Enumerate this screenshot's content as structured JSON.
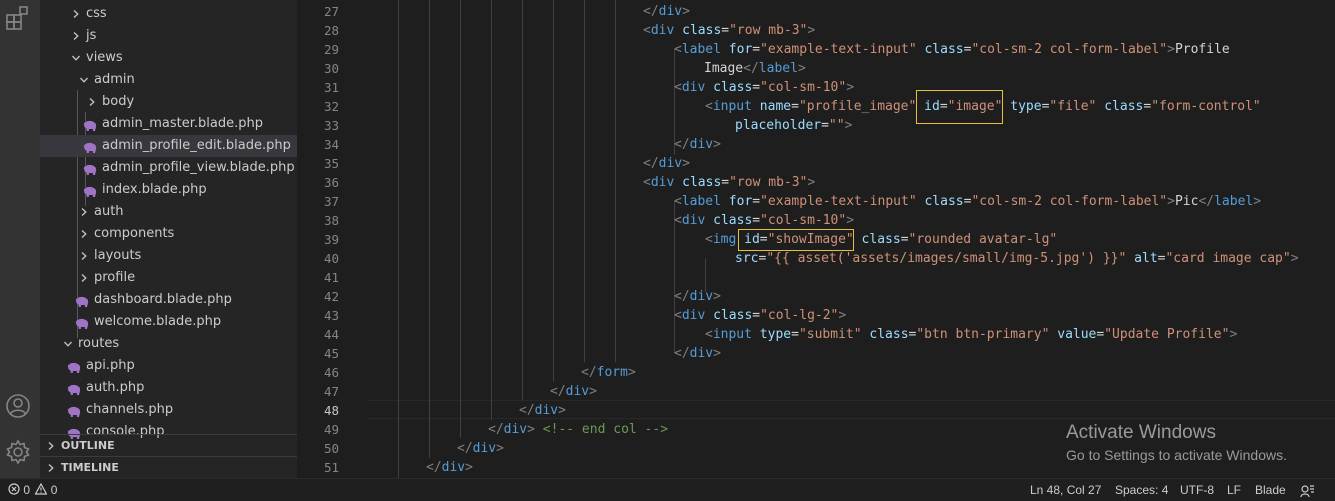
{
  "explorer": {
    "items": [
      {
        "label": "css",
        "chevron": "right",
        "icon": "none"
      },
      {
        "label": "js",
        "chevron": "right",
        "icon": "none"
      },
      {
        "label": "views",
        "chevron": "down",
        "icon": "none"
      },
      {
        "label": "admin",
        "chevron": "down",
        "icon": "none"
      },
      {
        "label": "body",
        "chevron": "right",
        "icon": "none"
      },
      {
        "label": "admin_master.blade.php",
        "chevron": "none",
        "icon": "php"
      },
      {
        "label": "admin_profile_edit.blade.php",
        "chevron": "none",
        "icon": "php",
        "active": true
      },
      {
        "label": "admin_profile_view.blade.php",
        "chevron": "none",
        "icon": "php"
      },
      {
        "label": "index.blade.php",
        "chevron": "none",
        "icon": "php"
      },
      {
        "label": "auth",
        "chevron": "right",
        "icon": "none"
      },
      {
        "label": "components",
        "chevron": "right",
        "icon": "none"
      },
      {
        "label": "layouts",
        "chevron": "right",
        "icon": "none"
      },
      {
        "label": "profile",
        "chevron": "right",
        "icon": "none"
      },
      {
        "label": "dashboard.blade.php",
        "chevron": "none",
        "icon": "php"
      },
      {
        "label": "welcome.blade.php",
        "chevron": "none",
        "icon": "php"
      },
      {
        "label": "routes",
        "chevron": "down",
        "icon": "none"
      },
      {
        "label": "api.php",
        "chevron": "none",
        "icon": "php"
      },
      {
        "label": "auth.php",
        "chevron": "none",
        "icon": "php"
      },
      {
        "label": "channels.php",
        "chevron": "none",
        "icon": "php"
      },
      {
        "label": "console.php",
        "chevron": "none",
        "icon": "php"
      }
    ],
    "outline_label": "OUTLINE",
    "timeline_label": "TIMELINE"
  },
  "editor": {
    "current_line": "48",
    "lines": [
      {
        "num": "27",
        "tokens": [
          [
            "t-punc",
            "</"
          ],
          [
            "t-tag",
            "div"
          ],
          [
            "t-punc",
            ">"
          ]
        ]
      },
      {
        "num": "28",
        "tokens": [
          [
            "t-punc",
            "<"
          ],
          [
            "t-tag",
            "div "
          ],
          [
            "t-attr",
            "class"
          ],
          [
            "t-eq",
            "="
          ],
          [
            "t-str",
            "\"row mb-3\""
          ],
          [
            "t-punc",
            ">"
          ]
        ]
      },
      {
        "num": "29",
        "tokens": [
          [
            "t-punc",
            "<"
          ],
          [
            "t-tag",
            "label "
          ],
          [
            "t-attr",
            "for"
          ],
          [
            "t-eq",
            "="
          ],
          [
            "t-str",
            "\"example-text-input\" "
          ],
          [
            "t-attr",
            "class"
          ],
          [
            "t-eq",
            "="
          ],
          [
            "t-str",
            "\"col-sm-2 col-form-label\""
          ],
          [
            "t-punc",
            ">"
          ],
          [
            "t-text",
            "Profile"
          ]
        ]
      },
      {
        "num": "30",
        "tokens": [
          [
            "t-text",
            "Image"
          ],
          [
            "t-punc",
            "</"
          ],
          [
            "t-tag",
            "label"
          ],
          [
            "t-punc",
            ">"
          ]
        ]
      },
      {
        "num": "31",
        "tokens": [
          [
            "t-punc",
            "<"
          ],
          [
            "t-tag",
            "div "
          ],
          [
            "t-attr",
            "class"
          ],
          [
            "t-eq",
            "="
          ],
          [
            "t-str",
            "\"col-sm-10\""
          ],
          [
            "t-punc",
            ">"
          ]
        ]
      },
      {
        "num": "32",
        "tokens": [
          [
            "t-punc",
            "<"
          ],
          [
            "t-tag",
            "input "
          ],
          [
            "t-attr",
            "name"
          ],
          [
            "t-eq",
            "="
          ],
          [
            "t-str",
            "\"profile_image\" "
          ],
          [
            "t-attr",
            "id"
          ],
          [
            "t-eq",
            "="
          ],
          [
            "t-str",
            "\"image\" "
          ],
          [
            "t-attr",
            "type"
          ],
          [
            "t-eq",
            "="
          ],
          [
            "t-str",
            "\"file\" "
          ],
          [
            "t-attr",
            "class"
          ],
          [
            "t-eq",
            "="
          ],
          [
            "t-str",
            "\"form-control\""
          ]
        ]
      },
      {
        "num": "33",
        "tokens": [
          [
            "t-attr",
            "placeholder"
          ],
          [
            "t-eq",
            "="
          ],
          [
            "t-str",
            "\"\""
          ],
          [
            "t-punc",
            ">"
          ]
        ]
      },
      {
        "num": "34",
        "tokens": [
          [
            "t-punc",
            "</"
          ],
          [
            "t-tag",
            "div"
          ],
          [
            "t-punc",
            ">"
          ]
        ]
      },
      {
        "num": "35",
        "tokens": [
          [
            "t-punc",
            "</"
          ],
          [
            "t-tag",
            "div"
          ],
          [
            "t-punc",
            ">"
          ]
        ]
      },
      {
        "num": "36",
        "tokens": [
          [
            "t-punc",
            "<"
          ],
          [
            "t-tag",
            "div "
          ],
          [
            "t-attr",
            "class"
          ],
          [
            "t-eq",
            "="
          ],
          [
            "t-str",
            "\"row mb-3\""
          ],
          [
            "t-punc",
            ">"
          ]
        ]
      },
      {
        "num": "37",
        "tokens": [
          [
            "t-punc",
            "<"
          ],
          [
            "t-tag",
            "label "
          ],
          [
            "t-attr",
            "for"
          ],
          [
            "t-eq",
            "="
          ],
          [
            "t-str",
            "\"example-text-input\" "
          ],
          [
            "t-attr",
            "class"
          ],
          [
            "t-eq",
            "="
          ],
          [
            "t-str",
            "\"col-sm-2 col-form-label\""
          ],
          [
            "t-punc",
            ">"
          ],
          [
            "t-text",
            "Pic"
          ],
          [
            "t-punc",
            "</"
          ],
          [
            "t-tag",
            "label"
          ],
          [
            "t-punc",
            ">"
          ]
        ]
      },
      {
        "num": "38",
        "tokens": [
          [
            "t-punc",
            "<"
          ],
          [
            "t-tag",
            "div "
          ],
          [
            "t-attr",
            "class"
          ],
          [
            "t-eq",
            "="
          ],
          [
            "t-str",
            "\"col-sm-10\""
          ],
          [
            "t-punc",
            ">"
          ]
        ]
      },
      {
        "num": "39",
        "tokens": [
          [
            "t-punc",
            "<"
          ],
          [
            "t-tag",
            "img "
          ],
          [
            "t-attr",
            "id"
          ],
          [
            "t-eq",
            "="
          ],
          [
            "t-str",
            "\"showImage\" "
          ],
          [
            "t-attr",
            "class"
          ],
          [
            "t-eq",
            "="
          ],
          [
            "t-str",
            "\"rounded avatar-lg\""
          ]
        ]
      },
      {
        "num": "40",
        "tokens": [
          [
            "t-attr",
            "src"
          ],
          [
            "t-eq",
            "="
          ],
          [
            "t-str",
            "\"{{ asset('assets/images/small/img-5.jpg') }}\" "
          ],
          [
            "t-attr",
            "alt"
          ],
          [
            "t-eq",
            "="
          ],
          [
            "t-str",
            "\"card image cap\""
          ],
          [
            "t-punc",
            ">"
          ]
        ]
      },
      {
        "num": "41",
        "tokens": []
      },
      {
        "num": "42",
        "tokens": [
          [
            "t-punc",
            "</"
          ],
          [
            "t-tag",
            "div"
          ],
          [
            "t-punc",
            ">"
          ]
        ]
      },
      {
        "num": "43",
        "tokens": [
          [
            "t-punc",
            "<"
          ],
          [
            "t-tag",
            "div "
          ],
          [
            "t-attr",
            "class"
          ],
          [
            "t-eq",
            "="
          ],
          [
            "t-str",
            "\"col-lg-2\""
          ],
          [
            "t-punc",
            ">"
          ]
        ]
      },
      {
        "num": "44",
        "tokens": [
          [
            "t-punc",
            "<"
          ],
          [
            "t-tag",
            "input "
          ],
          [
            "t-attr",
            "type"
          ],
          [
            "t-eq",
            "="
          ],
          [
            "t-str",
            "\"submit\" "
          ],
          [
            "t-attr",
            "class"
          ],
          [
            "t-eq",
            "="
          ],
          [
            "t-str",
            "\"btn btn-primary\" "
          ],
          [
            "t-attr",
            "value"
          ],
          [
            "t-eq",
            "="
          ],
          [
            "t-str",
            "\"Update Profile\""
          ],
          [
            "t-punc",
            ">"
          ]
        ]
      },
      {
        "num": "45",
        "tokens": [
          [
            "t-punc",
            "</"
          ],
          [
            "t-tag",
            "div"
          ],
          [
            "t-punc",
            ">"
          ]
        ]
      },
      {
        "num": "46",
        "tokens": [
          [
            "t-punc",
            "</"
          ],
          [
            "t-tag",
            "form"
          ],
          [
            "t-punc",
            ">"
          ]
        ]
      },
      {
        "num": "47",
        "tokens": [
          [
            "t-punc",
            "</"
          ],
          [
            "t-tag",
            "div"
          ],
          [
            "t-punc",
            ">"
          ]
        ]
      },
      {
        "num": "48",
        "tokens": [
          [
            "t-punc",
            "</"
          ],
          [
            "t-tag",
            "div"
          ],
          [
            "t-punc",
            ">"
          ]
        ]
      },
      {
        "num": "49",
        "tokens": [
          [
            "t-punc",
            "</"
          ],
          [
            "t-tag",
            "div"
          ],
          [
            "t-punc",
            "> "
          ],
          [
            "t-cmt",
            "<!-- end col -->"
          ]
        ]
      },
      {
        "num": "50",
        "tokens": [
          [
            "t-punc",
            "</"
          ],
          [
            "t-tag",
            "div"
          ],
          [
            "t-punc",
            ">"
          ]
        ]
      },
      {
        "num": "51",
        "tokens": [
          [
            "t-punc",
            "</"
          ],
          [
            "t-tag",
            "div"
          ],
          [
            "t-punc",
            ">"
          ]
        ]
      }
    ]
  },
  "watermark": {
    "title": "Activate Windows",
    "subtitle": "Go to Settings to activate Windows."
  },
  "statusbar": {
    "errors": "0",
    "warnings": "0",
    "position": "Ln 48, Col 27",
    "spaces": "Spaces: 4",
    "encoding": "UTF-8",
    "eol": "LF",
    "language": "Blade"
  },
  "colors": {
    "accent_highlight": "#e3c23a",
    "php_icon": "#a074c4",
    "tag": "#569cd6",
    "attr": "#9cdcfe",
    "string": "#ce9178",
    "comment": "#6a9955"
  },
  "icons": [
    "explorer-icon",
    "extensions-icon",
    "account-icon",
    "settings-gear-icon",
    "chevron-right-icon",
    "chevron-down-icon",
    "php-elephant-icon",
    "error-icon",
    "warning-icon",
    "feedback-icon"
  ]
}
